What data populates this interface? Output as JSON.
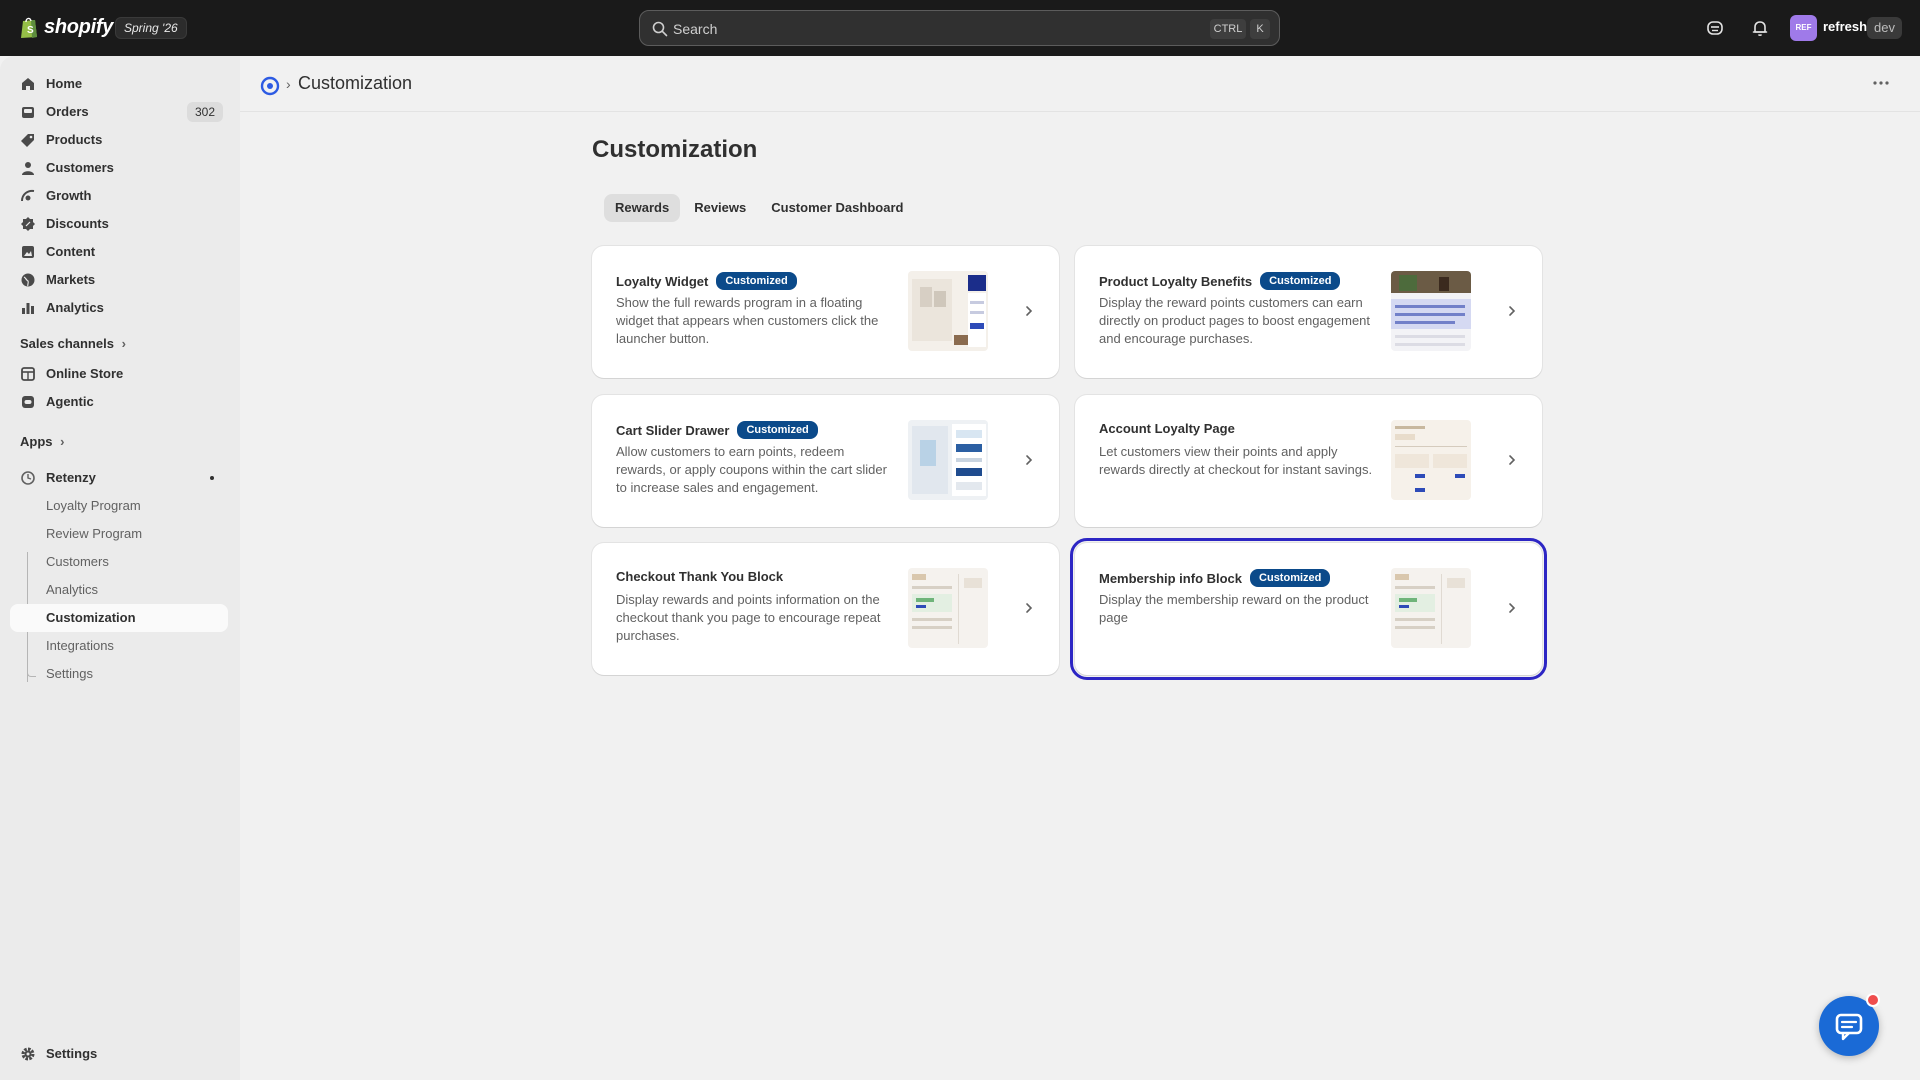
{
  "topbar": {
    "brand": "shopify",
    "edition": "Spring '26",
    "search_placeholder": "Search",
    "shortcut_ctrl": "CTRL",
    "shortcut_k": "K",
    "store_initials": "REF",
    "store_name": "refresh",
    "store_badge": "dev"
  },
  "sidebar": {
    "main_items": [
      {
        "label": "Home",
        "icon": "home-icon"
      },
      {
        "label": "Orders",
        "icon": "orders-icon",
        "count": "302"
      },
      {
        "label": "Products",
        "icon": "tag-icon"
      },
      {
        "label": "Customers",
        "icon": "person-icon"
      },
      {
        "label": "Growth",
        "icon": "growth-icon"
      },
      {
        "label": "Discounts",
        "icon": "discount-icon"
      },
      {
        "label": "Content",
        "icon": "content-icon"
      },
      {
        "label": "Markets",
        "icon": "globe-icon"
      },
      {
        "label": "Analytics",
        "icon": "bar-chart-icon"
      }
    ],
    "sales_channels_label": "Sales channels",
    "channels": [
      {
        "label": "Online Store",
        "icon": "store-icon"
      },
      {
        "label": "Agentic",
        "icon": "agentic-icon"
      }
    ],
    "apps_label": "Apps",
    "app": {
      "label": "Retenzy",
      "icon": "retenzy-icon"
    },
    "app_items": [
      {
        "label": "Loyalty Program"
      },
      {
        "label": "Review Program"
      },
      {
        "label": "Customers"
      },
      {
        "label": "Analytics"
      },
      {
        "label": "Customization"
      },
      {
        "label": "Integrations"
      },
      {
        "label": "Settings"
      }
    ],
    "settings_label": "Settings"
  },
  "page": {
    "breadcrumb_title": "Customization",
    "title": "Customization",
    "tabs": [
      "Rewards",
      "Reviews",
      "Customer Dashboard"
    ],
    "selected_tab": "Rewards"
  },
  "cards": [
    {
      "title": "Loyalty Widget",
      "badge": "Customized",
      "desc": "Show the full rewards program in a floating widget that appears when customers click the launcher button."
    },
    {
      "title": "Product Loyalty Benefits",
      "badge": "Customized",
      "desc": "Display the reward points customers can earn directly on product pages to boost engagement and encourage purchases."
    },
    {
      "title": "Cart Slider Drawer",
      "badge": "Customized",
      "desc": "Allow customers to earn points, redeem rewards, or apply coupons within the cart slider to increase sales and engagement."
    },
    {
      "title": "Account Loyalty Page",
      "badge": "",
      "desc": "Let customers view their points and apply rewards directly at checkout for instant savings."
    },
    {
      "title": "Checkout Thank You Block",
      "badge": "",
      "desc": "Display rewards and points information on the checkout thank you page to encourage repeat purchases."
    },
    {
      "title": "Membership info Block",
      "badge": "Customized",
      "desc": "Display the membership reward on the product page"
    }
  ],
  "colors": {
    "topbar": "#1a1a1a",
    "badge": "#0b4a8a",
    "focus_outline": "#2d26c4",
    "chat_button": "#1a6ad6",
    "notification_dot": "#ef4d4d"
  }
}
